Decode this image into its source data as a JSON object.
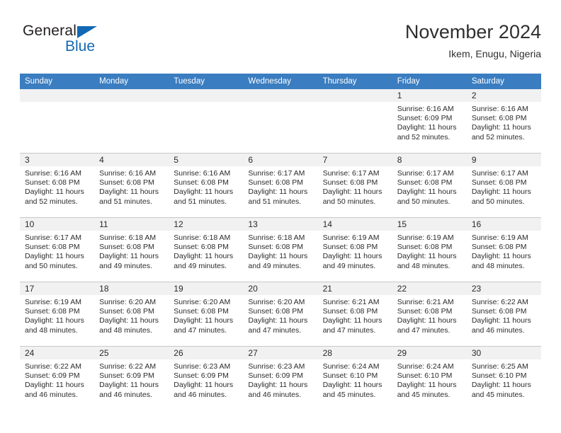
{
  "brand": {
    "name_top": "General",
    "name_bottom": "Blue",
    "accent_color": "#1268b3"
  },
  "header": {
    "title": "November 2024",
    "location": "Ikem, Enugu, Nigeria"
  },
  "theme": {
    "header_row_bg": "#3a7dc0",
    "date_strip_bg": "#f1f1f1",
    "grid_line": "#c8c8c8"
  },
  "calendar": {
    "weekday_headers": [
      "Sunday",
      "Monday",
      "Tuesday",
      "Wednesday",
      "Thursday",
      "Friday",
      "Saturday"
    ],
    "weeks": [
      [
        {
          "date": "",
          "empty": true
        },
        {
          "date": "",
          "empty": true
        },
        {
          "date": "",
          "empty": true
        },
        {
          "date": "",
          "empty": true
        },
        {
          "date": "",
          "empty": true
        },
        {
          "date": "1",
          "sunrise": "Sunrise: 6:16 AM",
          "sunset": "Sunset: 6:09 PM",
          "daylight": "Daylight: 11 hours and 52 minutes."
        },
        {
          "date": "2",
          "sunrise": "Sunrise: 6:16 AM",
          "sunset": "Sunset: 6:08 PM",
          "daylight": "Daylight: 11 hours and 52 minutes."
        }
      ],
      [
        {
          "date": "3",
          "sunrise": "Sunrise: 6:16 AM",
          "sunset": "Sunset: 6:08 PM",
          "daylight": "Daylight: 11 hours and 52 minutes."
        },
        {
          "date": "4",
          "sunrise": "Sunrise: 6:16 AM",
          "sunset": "Sunset: 6:08 PM",
          "daylight": "Daylight: 11 hours and 51 minutes."
        },
        {
          "date": "5",
          "sunrise": "Sunrise: 6:16 AM",
          "sunset": "Sunset: 6:08 PM",
          "daylight": "Daylight: 11 hours and 51 minutes."
        },
        {
          "date": "6",
          "sunrise": "Sunrise: 6:17 AM",
          "sunset": "Sunset: 6:08 PM",
          "daylight": "Daylight: 11 hours and 51 minutes."
        },
        {
          "date": "7",
          "sunrise": "Sunrise: 6:17 AM",
          "sunset": "Sunset: 6:08 PM",
          "daylight": "Daylight: 11 hours and 50 minutes."
        },
        {
          "date": "8",
          "sunrise": "Sunrise: 6:17 AM",
          "sunset": "Sunset: 6:08 PM",
          "daylight": "Daylight: 11 hours and 50 minutes."
        },
        {
          "date": "9",
          "sunrise": "Sunrise: 6:17 AM",
          "sunset": "Sunset: 6:08 PM",
          "daylight": "Daylight: 11 hours and 50 minutes."
        }
      ],
      [
        {
          "date": "10",
          "sunrise": "Sunrise: 6:17 AM",
          "sunset": "Sunset: 6:08 PM",
          "daylight": "Daylight: 11 hours and 50 minutes."
        },
        {
          "date": "11",
          "sunrise": "Sunrise: 6:18 AM",
          "sunset": "Sunset: 6:08 PM",
          "daylight": "Daylight: 11 hours and 49 minutes."
        },
        {
          "date": "12",
          "sunrise": "Sunrise: 6:18 AM",
          "sunset": "Sunset: 6:08 PM",
          "daylight": "Daylight: 11 hours and 49 minutes."
        },
        {
          "date": "13",
          "sunrise": "Sunrise: 6:18 AM",
          "sunset": "Sunset: 6:08 PM",
          "daylight": "Daylight: 11 hours and 49 minutes."
        },
        {
          "date": "14",
          "sunrise": "Sunrise: 6:19 AM",
          "sunset": "Sunset: 6:08 PM",
          "daylight": "Daylight: 11 hours and 49 minutes."
        },
        {
          "date": "15",
          "sunrise": "Sunrise: 6:19 AM",
          "sunset": "Sunset: 6:08 PM",
          "daylight": "Daylight: 11 hours and 48 minutes."
        },
        {
          "date": "16",
          "sunrise": "Sunrise: 6:19 AM",
          "sunset": "Sunset: 6:08 PM",
          "daylight": "Daylight: 11 hours and 48 minutes."
        }
      ],
      [
        {
          "date": "17",
          "sunrise": "Sunrise: 6:19 AM",
          "sunset": "Sunset: 6:08 PM",
          "daylight": "Daylight: 11 hours and 48 minutes."
        },
        {
          "date": "18",
          "sunrise": "Sunrise: 6:20 AM",
          "sunset": "Sunset: 6:08 PM",
          "daylight": "Daylight: 11 hours and 48 minutes."
        },
        {
          "date": "19",
          "sunrise": "Sunrise: 6:20 AM",
          "sunset": "Sunset: 6:08 PM",
          "daylight": "Daylight: 11 hours and 47 minutes."
        },
        {
          "date": "20",
          "sunrise": "Sunrise: 6:20 AM",
          "sunset": "Sunset: 6:08 PM",
          "daylight": "Daylight: 11 hours and 47 minutes."
        },
        {
          "date": "21",
          "sunrise": "Sunrise: 6:21 AM",
          "sunset": "Sunset: 6:08 PM",
          "daylight": "Daylight: 11 hours and 47 minutes."
        },
        {
          "date": "22",
          "sunrise": "Sunrise: 6:21 AM",
          "sunset": "Sunset: 6:08 PM",
          "daylight": "Daylight: 11 hours and 47 minutes."
        },
        {
          "date": "23",
          "sunrise": "Sunrise: 6:22 AM",
          "sunset": "Sunset: 6:08 PM",
          "daylight": "Daylight: 11 hours and 46 minutes."
        }
      ],
      [
        {
          "date": "24",
          "sunrise": "Sunrise: 6:22 AM",
          "sunset": "Sunset: 6:09 PM",
          "daylight": "Daylight: 11 hours and 46 minutes."
        },
        {
          "date": "25",
          "sunrise": "Sunrise: 6:22 AM",
          "sunset": "Sunset: 6:09 PM",
          "daylight": "Daylight: 11 hours and 46 minutes."
        },
        {
          "date": "26",
          "sunrise": "Sunrise: 6:23 AM",
          "sunset": "Sunset: 6:09 PM",
          "daylight": "Daylight: 11 hours and 46 minutes."
        },
        {
          "date": "27",
          "sunrise": "Sunrise: 6:23 AM",
          "sunset": "Sunset: 6:09 PM",
          "daylight": "Daylight: 11 hours and 46 minutes."
        },
        {
          "date": "28",
          "sunrise": "Sunrise: 6:24 AM",
          "sunset": "Sunset: 6:10 PM",
          "daylight": "Daylight: 11 hours and 45 minutes."
        },
        {
          "date": "29",
          "sunrise": "Sunrise: 6:24 AM",
          "sunset": "Sunset: 6:10 PM",
          "daylight": "Daylight: 11 hours and 45 minutes."
        },
        {
          "date": "30",
          "sunrise": "Sunrise: 6:25 AM",
          "sunset": "Sunset: 6:10 PM",
          "daylight": "Daylight: 11 hours and 45 minutes."
        }
      ]
    ]
  }
}
